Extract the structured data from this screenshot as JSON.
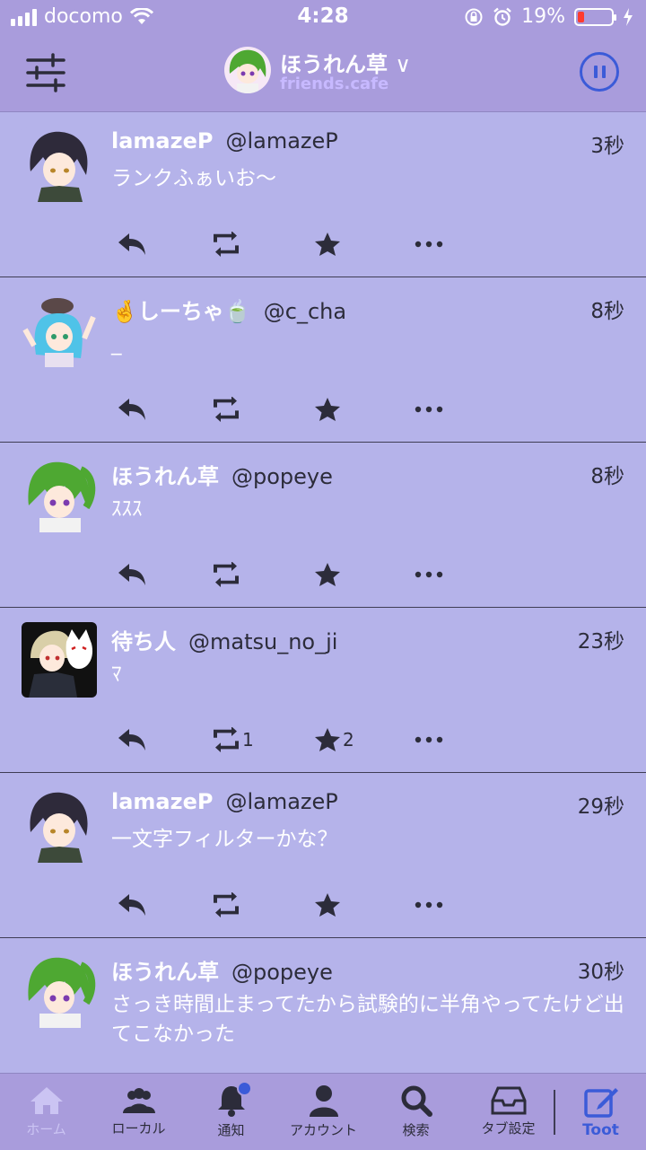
{
  "status": {
    "carrier": "docomo",
    "time": "4:28",
    "battery": "19%",
    "battery_level": 0.19
  },
  "header": {
    "account_name": "ほうれん草",
    "account_domain": "friends.cafe"
  },
  "posts": [
    {
      "name": "lamazeP",
      "handle": "@lamazeP",
      "time": "3秒",
      "content": "ランクふぁいお〜",
      "boosts": "",
      "favs": "",
      "avatar": "dark-hair-boy-avatar"
    },
    {
      "name": "🤞しーちゃ🍵",
      "handle": "@c_cha",
      "time": "8秒",
      "content": "_",
      "boosts": "",
      "favs": "",
      "avatar": "blue-hair-girl-avatar"
    },
    {
      "name": "ほうれん草",
      "handle": "@popeye",
      "time": "8秒",
      "content": "ｽｽｽ",
      "boosts": "",
      "favs": "",
      "avatar": "green-hair-girl-avatar"
    },
    {
      "name": "待ち人",
      "handle": "@matsu_no_ji",
      "time": "23秒",
      "content": "ﾏ",
      "boosts": "1",
      "favs": "2",
      "avatar": "fox-mask-avatar"
    },
    {
      "name": "lamazeP",
      "handle": "@lamazeP",
      "time": "29秒",
      "content": "一文字フィルターかな？",
      "boosts": "",
      "favs": "",
      "avatar": "dark-hair-boy-avatar"
    },
    {
      "name": "ほうれん草",
      "handle": "@popeye",
      "time": "30秒",
      "content": "さっき時間止まってたから試験的に半角やってたけど出てこなかった",
      "boosts": "",
      "favs": "",
      "avatar": "green-hair-girl-avatar"
    }
  ],
  "tabs": [
    {
      "label": "ホーム",
      "icon": "home-icon"
    },
    {
      "label": "ローカル",
      "icon": "people-icon"
    },
    {
      "label": "通知",
      "icon": "bell-icon"
    },
    {
      "label": "アカウント",
      "icon": "person-icon"
    },
    {
      "label": "検索",
      "icon": "search-icon"
    },
    {
      "label": "タブ設定",
      "icon": "inbox-icon"
    },
    {
      "label": "Toot",
      "icon": "compose-icon"
    }
  ],
  "colors": {
    "accent": "#3b5bd8",
    "header": "#a99cdc",
    "background": "#b5b3ea"
  }
}
